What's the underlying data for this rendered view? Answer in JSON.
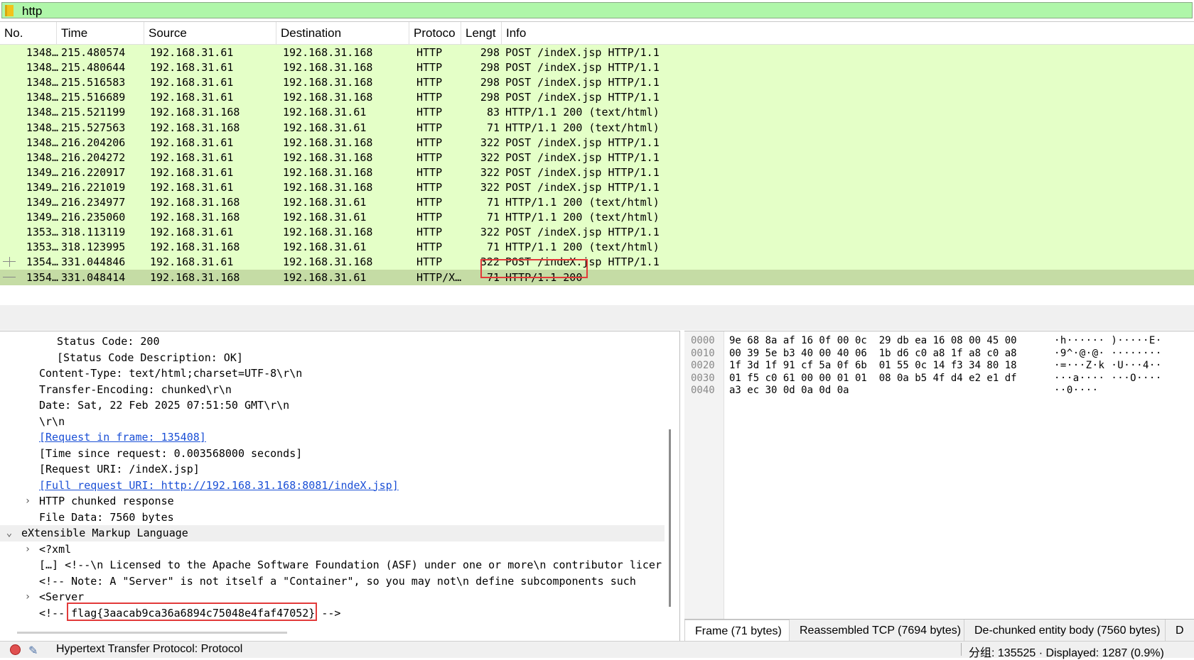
{
  "filter": {
    "text": "http"
  },
  "columns": {
    "no": "No.",
    "time": "Time",
    "source": "Source",
    "destination": "Destination",
    "protocol": "Protoco",
    "length": "Lengt",
    "info": "Info"
  },
  "packets": [
    {
      "no": "1348…",
      "time": "215.480574",
      "src": "192.168.31.61",
      "dst": "192.168.31.168",
      "proto": "HTTP",
      "len": "298",
      "info": "POST /indeX.jsp HTTP/1.1"
    },
    {
      "no": "1348…",
      "time": "215.480644",
      "src": "192.168.31.61",
      "dst": "192.168.31.168",
      "proto": "HTTP",
      "len": "298",
      "info": "POST /indeX.jsp HTTP/1.1"
    },
    {
      "no": "1348…",
      "time": "215.516583",
      "src": "192.168.31.61",
      "dst": "192.168.31.168",
      "proto": "HTTP",
      "len": "298",
      "info": "POST /indeX.jsp HTTP/1.1"
    },
    {
      "no": "1348…",
      "time": "215.516689",
      "src": "192.168.31.61",
      "dst": "192.168.31.168",
      "proto": "HTTP",
      "len": "298",
      "info": "POST /indeX.jsp HTTP/1.1"
    },
    {
      "no": "1348…",
      "time": "215.521199",
      "src": "192.168.31.168",
      "dst": "192.168.31.61",
      "proto": "HTTP",
      "len": "83",
      "info": "HTTP/1.1 200   (text/html)"
    },
    {
      "no": "1348…",
      "time": "215.527563",
      "src": "192.168.31.168",
      "dst": "192.168.31.61",
      "proto": "HTTP",
      "len": "71",
      "info": "HTTP/1.1 200   (text/html)"
    },
    {
      "no": "1348…",
      "time": "216.204206",
      "src": "192.168.31.61",
      "dst": "192.168.31.168",
      "proto": "HTTP",
      "len": "322",
      "info": "POST /indeX.jsp HTTP/1.1"
    },
    {
      "no": "1348…",
      "time": "216.204272",
      "src": "192.168.31.61",
      "dst": "192.168.31.168",
      "proto": "HTTP",
      "len": "322",
      "info": "POST /indeX.jsp HTTP/1.1"
    },
    {
      "no": "1349…",
      "time": "216.220917",
      "src": "192.168.31.61",
      "dst": "192.168.31.168",
      "proto": "HTTP",
      "len": "322",
      "info": "POST /indeX.jsp HTTP/1.1"
    },
    {
      "no": "1349…",
      "time": "216.221019",
      "src": "192.168.31.61",
      "dst": "192.168.31.168",
      "proto": "HTTP",
      "len": "322",
      "info": "POST /indeX.jsp HTTP/1.1"
    },
    {
      "no": "1349…",
      "time": "216.234977",
      "src": "192.168.31.168",
      "dst": "192.168.31.61",
      "proto": "HTTP",
      "len": "71",
      "info": "HTTP/1.1 200   (text/html)"
    },
    {
      "no": "1349…",
      "time": "216.235060",
      "src": "192.168.31.168",
      "dst": "192.168.31.61",
      "proto": "HTTP",
      "len": "71",
      "info": "HTTP/1.1 200   (text/html)"
    },
    {
      "no": "1353…",
      "time": "318.113119",
      "src": "192.168.31.61",
      "dst": "192.168.31.168",
      "proto": "HTTP",
      "len": "322",
      "info": "POST /indeX.jsp HTTP/1.1"
    },
    {
      "no": "1353…",
      "time": "318.123995",
      "src": "192.168.31.168",
      "dst": "192.168.31.61",
      "proto": "HTTP",
      "len": "71",
      "info": "HTTP/1.1 200   (text/html)"
    },
    {
      "no": "1354…",
      "time": "331.044846",
      "src": "192.168.31.61",
      "dst": "192.168.31.168",
      "proto": "HTTP",
      "len": "322",
      "info": "POST /indeX.jsp HTTP/1.1"
    },
    {
      "no": "1354…",
      "time": "331.048414",
      "src": "192.168.31.168",
      "dst": "192.168.31.61",
      "proto": "HTTP/X…",
      "len": "71",
      "info": "HTTP/1.1 200"
    }
  ],
  "details": {
    "status_code": "Status Code: 200",
    "status_desc": "[Status Code Description: OK]",
    "content_type": "Content-Type: text/html;charset=UTF-8\\r\\n",
    "transfer_encoding": "Transfer-Encoding: chunked\\r\\n",
    "date": "Date: Sat, 22 Feb 2025 07:51:50 GMT\\r\\n",
    "crlf": "\\r\\n",
    "request_in_frame": "[Request in frame: 135408]",
    "time_since": "[Time since request: 0.003568000 seconds]",
    "request_uri": "[Request URI: /indeX.jsp]",
    "full_request_uri": "[Full request URI: http://192.168.31.168:8081/indeX.jsp]",
    "chunked_response": "HTTP chunked response",
    "file_data": "File Data: 7560 bytes",
    "xml_root": "eXtensible Markup Language",
    "xml_decl": "<?xml",
    "xml_comment1": "[…] <!--\\n  Licensed to the Apache Software Foundation (ASF) under one or more\\n  contributor licer",
    "xml_comment2": "<!-- Note:  A \"Server\" is not itself a \"Container\", so you may not\\n     define subcomponents such",
    "xml_server": "<Server",
    "flag_prefix": "<!--",
    "flag": "flag{3aacab9ca36a6894c75048e4faf47052}",
    "flag_suffix": "-->"
  },
  "bytes": {
    "offsets": [
      "0000",
      "0010",
      "0020",
      "0030",
      "0040"
    ],
    "hex": [
      "9e 68 8a af 16 0f 00 0c  29 db ea 16 08 00 45 00",
      "00 39 5e b3 40 00 40 06  1b d6 c0 a8 1f a8 c0 a8",
      "1f 3d 1f 91 cf 5a 0f 6b  01 55 0c 14 f3 34 80 18",
      "01 f5 c0 61 00 00 01 01  08 0a b5 4f d4 e2 e1 df",
      "a3 ec 30 0d 0a 0d 0a"
    ],
    "ascii": [
      "·h······ )·····E·",
      "·9^·@·@· ········",
      "·=···Z·k ·U···4··",
      "···a···· ···O····",
      "··0····"
    ]
  },
  "bytes_tabs": [
    "Frame (71 bytes)",
    "Reassembled TCP (7694 bytes)",
    "De-chunked entity body (7560 bytes)",
    "D"
  ],
  "status": {
    "left": "Hypertext Transfer Protocol: Protocol",
    "right": "分组: 135525 · Displayed: 1287 (0.9%)"
  }
}
